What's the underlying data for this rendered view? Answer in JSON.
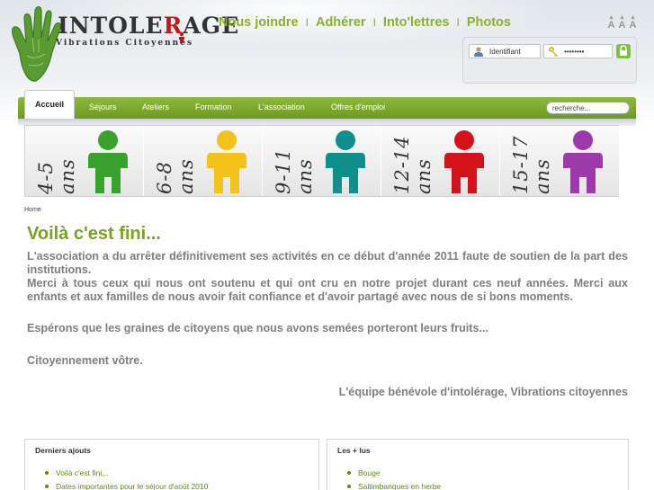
{
  "header": {
    "logo_title_main": "INTOLE",
    "logo_title_accent": "R",
    "logo_title_end": "AGE",
    "logo_subtitle": "Vibrations Citoyennes",
    "top_links": [
      {
        "label": "Nous joindre"
      },
      {
        "label": "Adhérer"
      },
      {
        "label": "Into'lettres"
      },
      {
        "label": "Photos"
      }
    ],
    "top_separator": "I",
    "font_sizes": [
      "A",
      "A",
      "A"
    ]
  },
  "login": {
    "username_value": "Identifiant",
    "password_value": "••••••••"
  },
  "nav": {
    "active": "Accueil",
    "items": [
      {
        "label": "Séjours"
      },
      {
        "label": "Ateliers"
      },
      {
        "label": "Formation"
      },
      {
        "label": "L'association"
      },
      {
        "label": "Offres d'emploi"
      }
    ],
    "search_value": "recherche..."
  },
  "ages": [
    {
      "label": "4-5 ans",
      "color": "#3aa02e"
    },
    {
      "label": "6-8 ans",
      "color": "#f2c21b"
    },
    {
      "label": "9-11 ans",
      "color": "#0f8f8c"
    },
    {
      "label": "12-14 ans",
      "color": "#d4121a"
    },
    {
      "label": "15-17 ans",
      "color": "#9b3aa8"
    }
  ],
  "breadcrumb": "Home",
  "page": {
    "title": "Voilà c'est fini...",
    "paragraphs": [
      "L'association a du arrêter définitivement ses activités en ce début d'année 2011 faute de soutien de la part des institutions.",
      "Merci à tous ceux qui nous ont soutenu et qui ont cru en notre projet durant ces neuf années. Merci aux enfants et aux familles de nous avoir fait confiance et d'avoir partagé avec nous de si bons moments.",
      "Espérons que les graines de citoyens que nous avons semées porteront leurs fruits...",
      "Citoyennement vôtre.",
      "L'équipe bénévole d'intolérage, Vibrations citoyennes"
    ]
  },
  "boxes": {
    "latest": {
      "title": "Derniers ajouts",
      "items": [
        "Voilà c'est fini...",
        "Dates importantes pour le séjour d'août 2010"
      ]
    },
    "popular": {
      "title": "Les + lus",
      "items": [
        "Bouge",
        "Saltimbanques en herbe"
      ]
    }
  },
  "colors": {
    "brand_green": "#78a322",
    "nav_green": "#7ea82c",
    "text_grey": "#7f7f7f"
  }
}
